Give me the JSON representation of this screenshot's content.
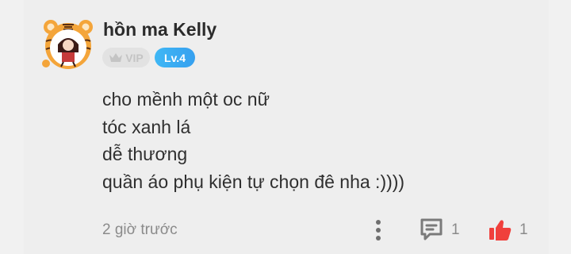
{
  "comment": {
    "username": "hồn ma Kelly",
    "vip_label": "VIP",
    "level_label": "Lv.4",
    "lines": [
      "cho mềnh một oc nữ",
      "tóc xanh lá",
      "dễ thương",
      "quần áo phụ kiện tự chọn đê nha :))))"
    ],
    "timestamp": "2 giờ trước",
    "reply_count": "1",
    "like_count": "1"
  },
  "icons": {
    "avatar": "tiger-frame-avatar",
    "vip": "crown-icon",
    "more": "more-vertical-icon",
    "reply": "comment-icon",
    "like": "thumbs-up-icon"
  },
  "colors": {
    "level_badge": "#3fb7f5",
    "like_icon": "#f0403c",
    "secondary_text": "#8a8a8a"
  }
}
